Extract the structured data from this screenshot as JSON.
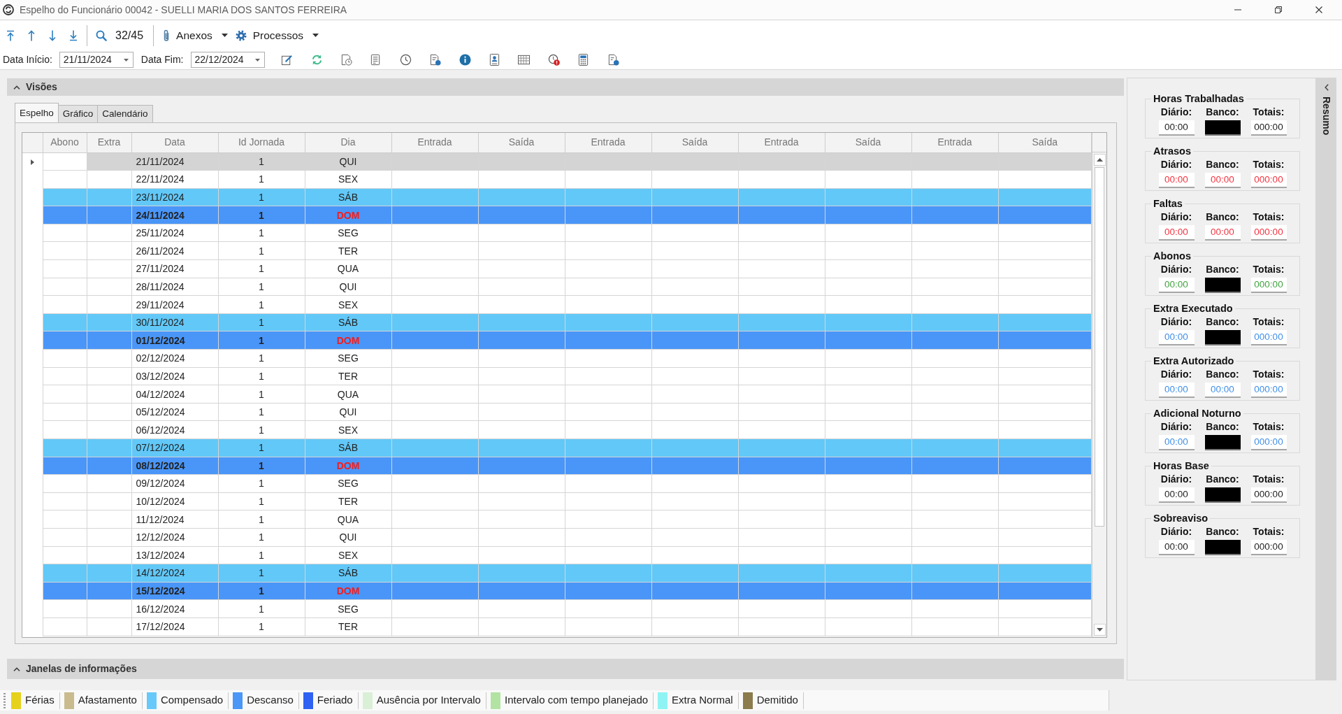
{
  "window": {
    "title": "Espelho do Funcionário 00042 - SUELLI MARIA DOS SANTOS FERREIRA"
  },
  "toolbar": {
    "record_counter": "32/45",
    "menus": [
      {
        "label": "Anexos"
      },
      {
        "label": "Processos"
      }
    ]
  },
  "date_filters": [
    {
      "label": "Data Início:",
      "value": "21/11/2024"
    },
    {
      "label": "Data Fim:",
      "value": "22/12/2024"
    }
  ],
  "views_panel": {
    "title": "Visões",
    "tabs": [
      {
        "label": "Espelho",
        "selected": true
      },
      {
        "label": "Gráfico",
        "selected": false
      },
      {
        "label": "Calendário",
        "selected": false
      }
    ],
    "table": {
      "columns": [
        "Abono",
        "Extra",
        "Data",
        "Id Jornada",
        "Dia",
        "Entrada",
        "Saída",
        "Entrada",
        "Saída",
        "Entrada",
        "Saída",
        "Entrada",
        "Saída"
      ],
      "rows": [
        {
          "date": "21/11/2024",
          "journey_id": "1",
          "weekday": "QUI",
          "kind": "normal",
          "selected": true
        },
        {
          "date": "22/11/2024",
          "journey_id": "1",
          "weekday": "SEX",
          "kind": "normal",
          "selected": false
        },
        {
          "date": "23/11/2024",
          "journey_id": "1",
          "weekday": "SÁB",
          "kind": "compensated",
          "selected": false
        },
        {
          "date": "24/11/2024",
          "journey_id": "1",
          "weekday": "DOM",
          "kind": "rest",
          "selected": false
        },
        {
          "date": "25/11/2024",
          "journey_id": "1",
          "weekday": "SEG",
          "kind": "normal",
          "selected": false
        },
        {
          "date": "26/11/2024",
          "journey_id": "1",
          "weekday": "TER",
          "kind": "normal",
          "selected": false
        },
        {
          "date": "27/11/2024",
          "journey_id": "1",
          "weekday": "QUA",
          "kind": "normal",
          "selected": false
        },
        {
          "date": "28/11/2024",
          "journey_id": "1",
          "weekday": "QUI",
          "kind": "normal",
          "selected": false
        },
        {
          "date": "29/11/2024",
          "journey_id": "1",
          "weekday": "SEX",
          "kind": "normal",
          "selected": false
        },
        {
          "date": "30/11/2024",
          "journey_id": "1",
          "weekday": "SÁB",
          "kind": "compensated",
          "selected": false
        },
        {
          "date": "01/12/2024",
          "journey_id": "1",
          "weekday": "DOM",
          "kind": "rest",
          "selected": false
        },
        {
          "date": "02/12/2024",
          "journey_id": "1",
          "weekday": "SEG",
          "kind": "normal",
          "selected": false
        },
        {
          "date": "03/12/2024",
          "journey_id": "1",
          "weekday": "TER",
          "kind": "normal",
          "selected": false
        },
        {
          "date": "04/12/2024",
          "journey_id": "1",
          "weekday": "QUA",
          "kind": "normal",
          "selected": false
        },
        {
          "date": "05/12/2024",
          "journey_id": "1",
          "weekday": "QUI",
          "kind": "normal",
          "selected": false
        },
        {
          "date": "06/12/2024",
          "journey_id": "1",
          "weekday": "SEX",
          "kind": "normal",
          "selected": false
        },
        {
          "date": "07/12/2024",
          "journey_id": "1",
          "weekday": "SÁB",
          "kind": "compensated",
          "selected": false
        },
        {
          "date": "08/12/2024",
          "journey_id": "1",
          "weekday": "DOM",
          "kind": "rest",
          "selected": false
        },
        {
          "date": "09/12/2024",
          "journey_id": "1",
          "weekday": "SEG",
          "kind": "normal",
          "selected": false
        },
        {
          "date": "10/12/2024",
          "journey_id": "1",
          "weekday": "TER",
          "kind": "normal",
          "selected": false
        },
        {
          "date": "11/12/2024",
          "journey_id": "1",
          "weekday": "QUA",
          "kind": "normal",
          "selected": false
        },
        {
          "date": "12/12/2024",
          "journey_id": "1",
          "weekday": "QUI",
          "kind": "normal",
          "selected": false
        },
        {
          "date": "13/12/2024",
          "journey_id": "1",
          "weekday": "SEX",
          "kind": "normal",
          "selected": false
        },
        {
          "date": "14/12/2024",
          "journey_id": "1",
          "weekday": "SÁB",
          "kind": "compensated",
          "selected": false
        },
        {
          "date": "15/12/2024",
          "journey_id": "1",
          "weekday": "DOM",
          "kind": "rest",
          "selected": false
        },
        {
          "date": "16/12/2024",
          "journey_id": "1",
          "weekday": "SEG",
          "kind": "normal",
          "selected": false
        },
        {
          "date": "17/12/2024",
          "journey_id": "1",
          "weekday": "TER",
          "kind": "normal",
          "selected": false
        }
      ]
    }
  },
  "info_panel": {
    "title": "Janelas de informações"
  },
  "summary_panel": {
    "title": "Resumo",
    "groups": [
      {
        "title": "Horas Trabalhadas",
        "color": "#1c1c1c",
        "fields": [
          {
            "label": "Diário:",
            "value": "00:00",
            "masked": false
          },
          {
            "label": "Banco:",
            "masked": true
          },
          {
            "label": "Totais:",
            "value": "000:00",
            "masked": false
          }
        ]
      },
      {
        "title": "Atrasos",
        "color": "#f2323f",
        "fields": [
          {
            "label": "Diário:",
            "value": "00:00",
            "masked": false
          },
          {
            "label": "Banco:",
            "value": "00:00",
            "masked": false
          },
          {
            "label": "Totais:",
            "value": "000:00",
            "masked": false
          }
        ]
      },
      {
        "title": "Faltas",
        "color": "#f2323f",
        "fields": [
          {
            "label": "Diário:",
            "value": "00:00",
            "masked": false
          },
          {
            "label": "Banco:",
            "value": "00:00",
            "masked": false
          },
          {
            "label": "Totais:",
            "value": "000:00",
            "masked": false
          }
        ]
      },
      {
        "title": "Abonos",
        "color": "#3fa33f",
        "fields": [
          {
            "label": "Diário:",
            "value": "00:00",
            "masked": false
          },
          {
            "label": "Banco:",
            "masked": true
          },
          {
            "label": "Totais:",
            "value": "000:00",
            "masked": false
          }
        ]
      },
      {
        "title": "Extra Executado",
        "color": "#3f8fe8",
        "fields": [
          {
            "label": "Diário:",
            "value": "00:00",
            "masked": false
          },
          {
            "label": "Banco:",
            "masked": true
          },
          {
            "label": "Totais:",
            "value": "000:00",
            "masked": false
          }
        ]
      },
      {
        "title": "Extra Autorizado",
        "color": "#3f8fe8",
        "fields": [
          {
            "label": "Diário:",
            "value": "00:00",
            "masked": false
          },
          {
            "label": "Banco:",
            "value": "00:00",
            "masked": false
          },
          {
            "label": "Totais:",
            "value": "000:00",
            "masked": false
          }
        ]
      },
      {
        "title": "Adicional Noturno",
        "color": "#3f8fe8",
        "fields": [
          {
            "label": "Diário:",
            "value": "00:00",
            "masked": false
          },
          {
            "label": "Banco:",
            "masked": true
          },
          {
            "label": "Totais:",
            "value": "000:00",
            "masked": false
          }
        ]
      },
      {
        "title": "Horas Base",
        "color": "#1c1c1c",
        "fields": [
          {
            "label": "Diário:",
            "value": "00:00",
            "masked": false
          },
          {
            "label": "Banco:",
            "masked": true
          },
          {
            "label": "Totais:",
            "value": "000:00",
            "masked": false
          }
        ]
      },
      {
        "title": "Sobreaviso",
        "color": "#1c1c1c",
        "fields": [
          {
            "label": "Diário:",
            "value": "00:00",
            "masked": false
          },
          {
            "label": "Banco:",
            "masked": true
          },
          {
            "label": "Totais:",
            "value": "000:00",
            "masked": false
          }
        ]
      }
    ]
  },
  "legend": [
    {
      "label": "Férias",
      "color": "#e6d21e"
    },
    {
      "label": "Afastamento",
      "color": "#c9bb8e"
    },
    {
      "label": "Compensado",
      "color": "#66c9f9"
    },
    {
      "label": "Descanso",
      "color": "#4a97f7"
    },
    {
      "label": "Feriado",
      "color": "#2f62f2"
    },
    {
      "label": "Ausência por Intervalo",
      "color": "#d9efd6"
    },
    {
      "label": "Intervalo com tempo planejado",
      "color": "#b3e3a3"
    },
    {
      "label": "Extra Normal",
      "color": "#8ff3f3"
    },
    {
      "label": "Demitido",
      "color": "#8b7b4d"
    }
  ]
}
